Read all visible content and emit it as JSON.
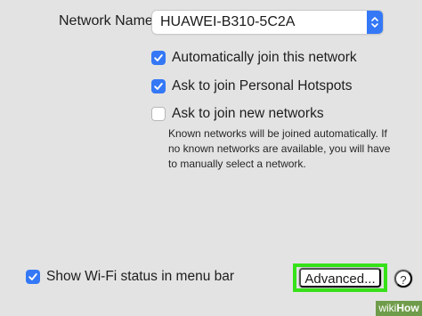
{
  "network": {
    "label": "Network Name:",
    "selected": "HUAWEI-B310-5C2A",
    "stepper_icon": "up-down-chevron-icon"
  },
  "options": [
    {
      "label": "Automatically join this network",
      "checked": true
    },
    {
      "label": "Ask to join Personal Hotspots",
      "checked": true
    },
    {
      "label": "Ask to join new networks",
      "checked": false
    }
  ],
  "note": "Known networks will be joined automatically. If no known networks are available, you will have to manually select a network.",
  "status_bar": {
    "label": "Show Wi-Fi status in menu bar",
    "checked": true
  },
  "buttons": {
    "advanced": "Advanced...",
    "help": "?"
  },
  "watermark": {
    "wiki": "wiki",
    "how": "How"
  },
  "colors": {
    "accent": "#3478f6",
    "highlight": "#37e119",
    "background": "#e3e3e3",
    "watermark": "#6f9c4a"
  }
}
